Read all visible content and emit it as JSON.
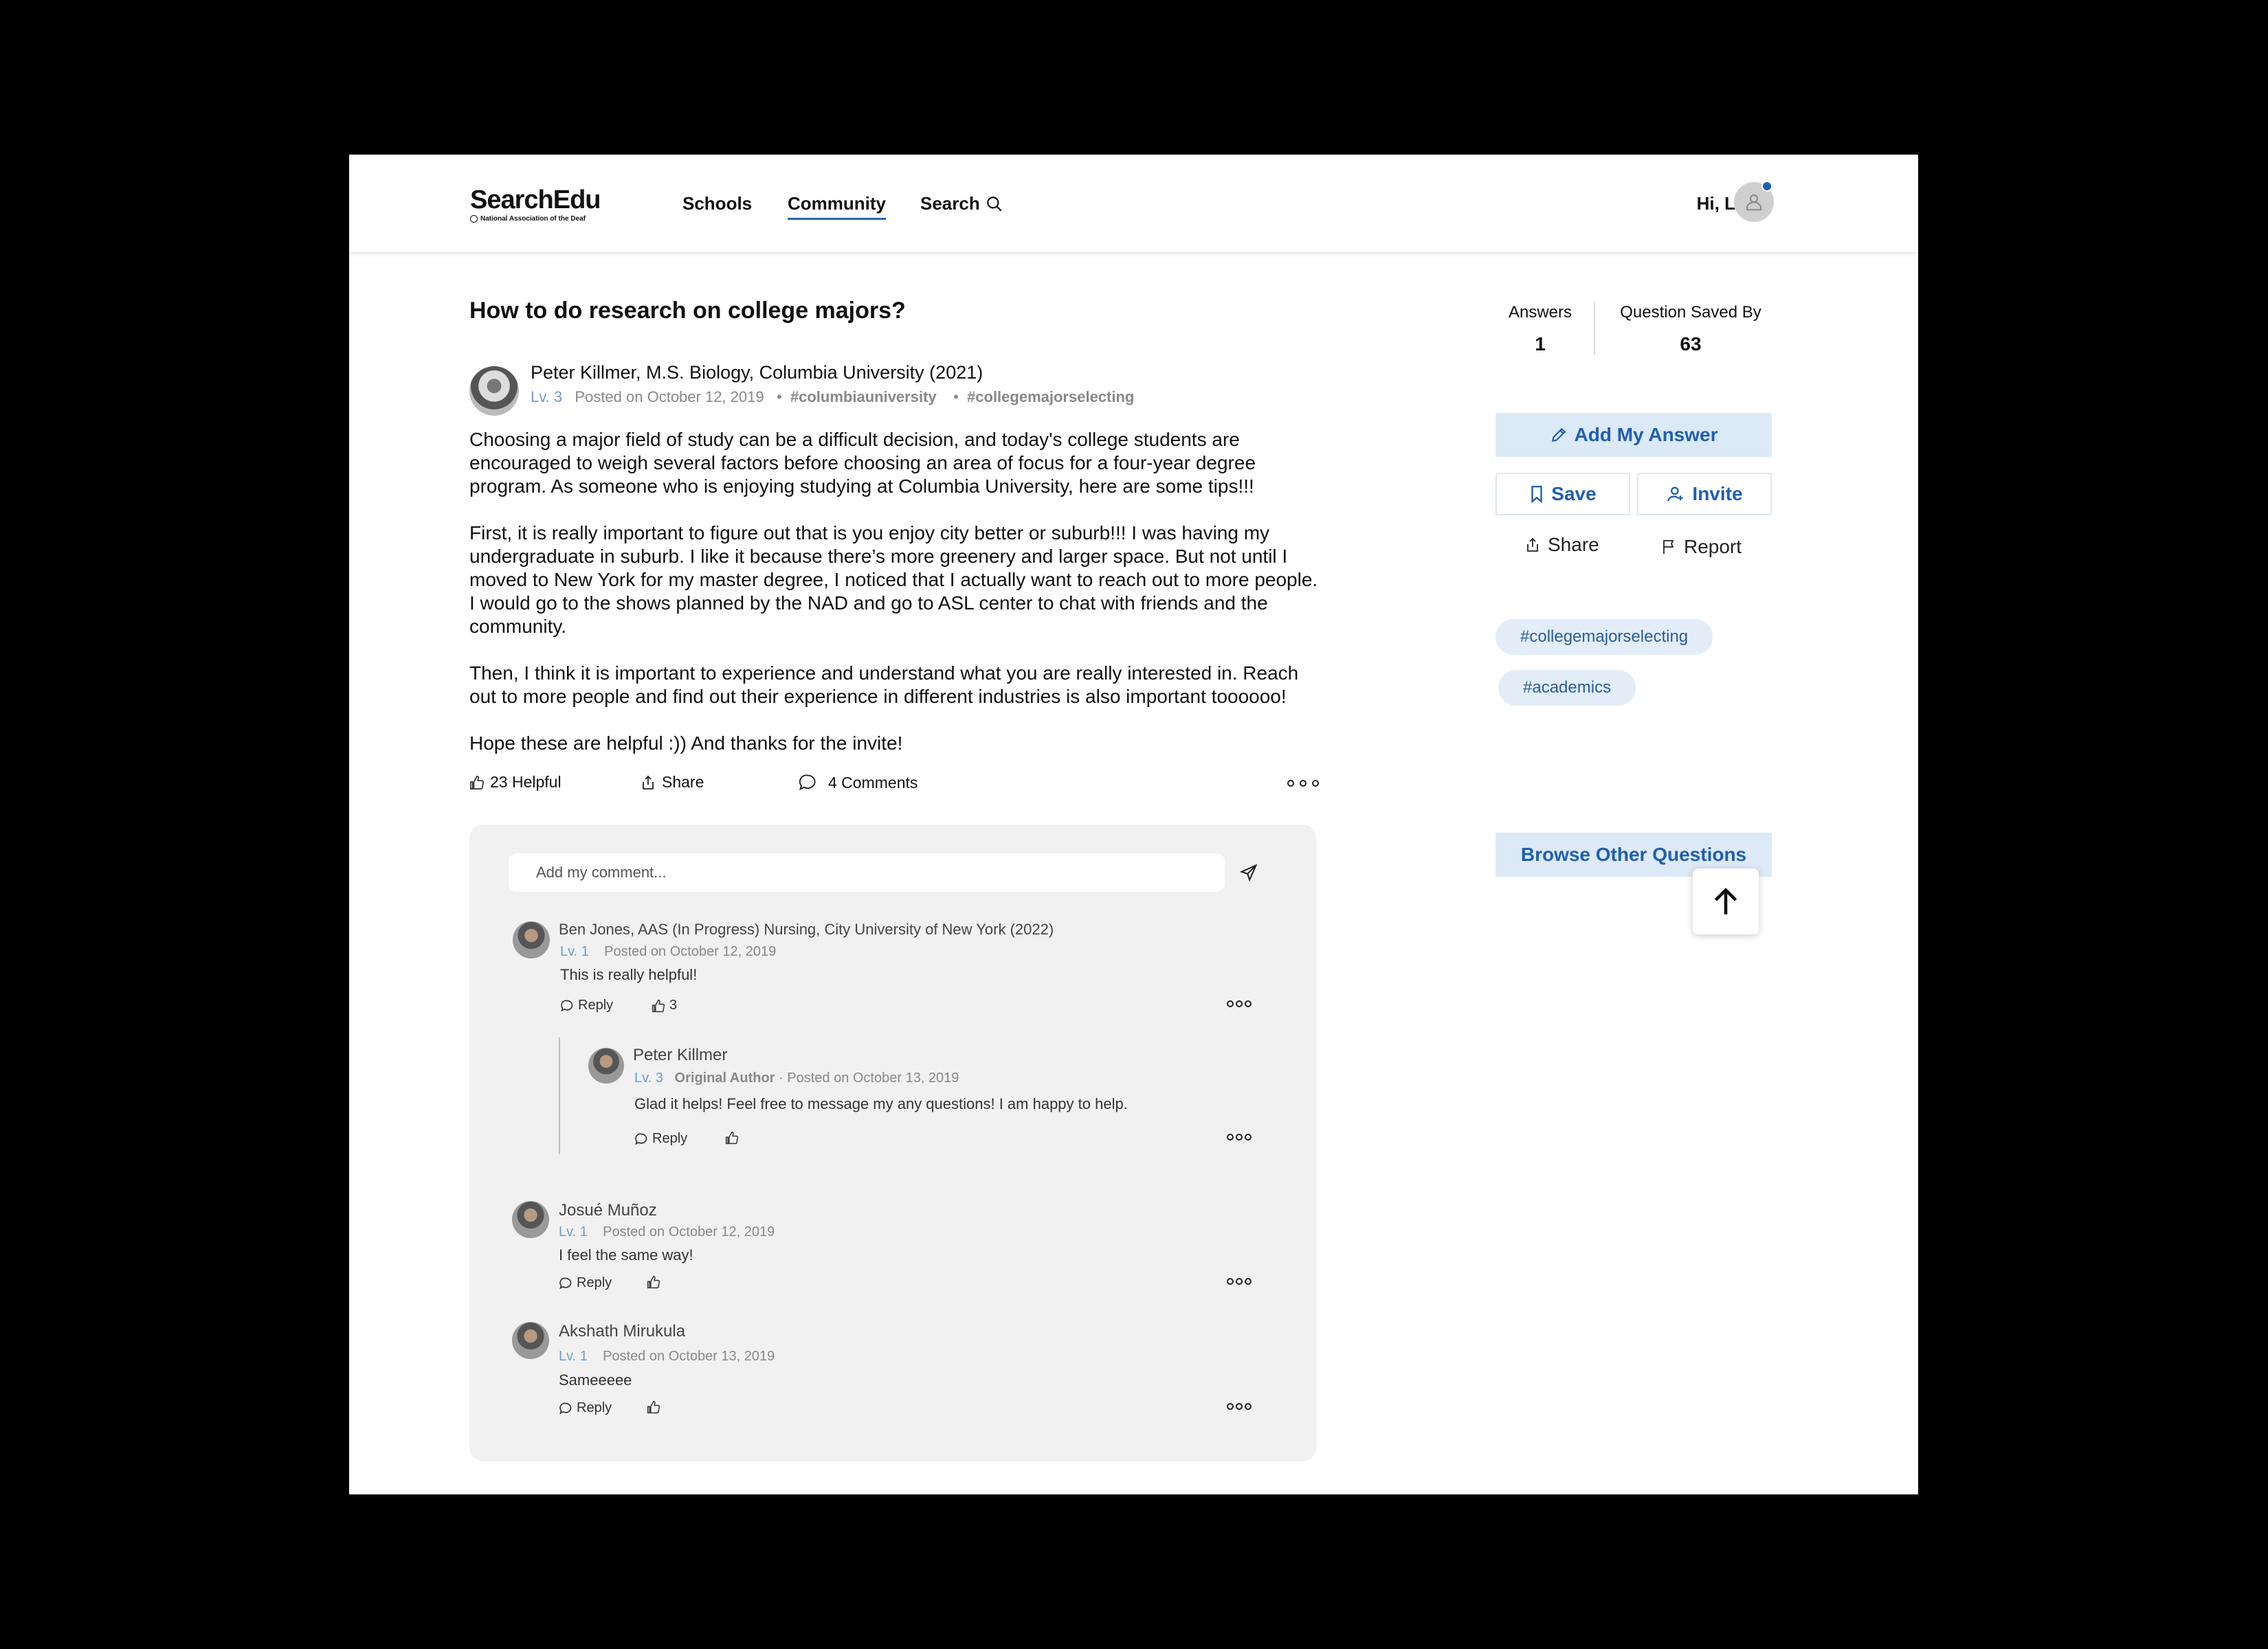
{
  "header": {
    "logo": "SearchEdu",
    "logo_sub": "National Association of the Deaf",
    "nav": {
      "schools": "Schools",
      "community": "Community",
      "search": "Search"
    },
    "greeting": "Hi, Lucia"
  },
  "question": {
    "title": "How to do research on college majors?",
    "author": "Peter Killmer, M.S. Biology, Columbia University (2021)",
    "level": "Lv. 3",
    "posted": "Posted on October 12, 2019",
    "sep": "•",
    "tags": [
      "#columbiauniversity",
      "#collegemajorselecting"
    ],
    "paragraphs": [
      "Choosing a major field of study can be a difficult decision, and today's college students are encouraged to weigh several factors before choosing an area of focus for a four-year degree program. As someone who is enjoying studying at Columbia University, here are some tips!!!",
      "First, it is really important to figure out that is you enjoy city better or suburb!!! I was having my undergraduate in suburb. I like it because there’s more greenery and larger space. But not until I moved to New York for my master degree, I noticed that I actually want to reach out to more people. I would go to the shows planned by the NAD and go to ASL center to chat with friends and the community.",
      "Then, I think it is important to experience and understand what you are really interested in. Reach out to more people and find out their experience in different industries is also important toooooo!",
      "Hope these are helpful :)) And thanks for the invite!"
    ],
    "helpful": "23 Helpful",
    "share": "Share",
    "comments_count": "4 Comments"
  },
  "comments": {
    "placeholder": "Add my comment...",
    "reply_label": "Reply",
    "items": [
      {
        "name": "Ben Jones, AAS (In Progress) Nursing, City University of New York (2022)",
        "level": "Lv. 1",
        "posted": "Posted on October 12, 2019",
        "text": "This is really helpful!",
        "likes": "3"
      },
      {
        "name": "Peter Killmer",
        "level": "Lv. 3",
        "badge": "Original Author",
        "posted": "· Posted on October 13, 2019",
        "text": "Glad it helps! Feel free to message my any questions! I am happy to help."
      },
      {
        "name": "Josué Muñoz",
        "level": "Lv. 1",
        "posted": "Posted on October 12, 2019",
        "text": "I feel the same way!"
      },
      {
        "name": "Akshath Mirukula",
        "level": "Lv. 1",
        "posted": "Posted on October 13, 2019",
        "text": "Sameeeee"
      }
    ]
  },
  "sidebar": {
    "answers_label": "Answers",
    "answers_value": "1",
    "saved_label": "Question Saved By",
    "saved_value": "63",
    "add_answer": "Add My Answer",
    "save": "Save",
    "invite": "Invite",
    "share": "Share",
    "report": "Report",
    "tags": [
      "#collegemajorselecting",
      "#academics"
    ],
    "browse": "Browse Other Questions"
  },
  "colors": {
    "accent": "#1f5fb0",
    "accent_bg": "#dce9f7",
    "level": "#6e9bd1",
    "panel": "#f1f1f1"
  }
}
